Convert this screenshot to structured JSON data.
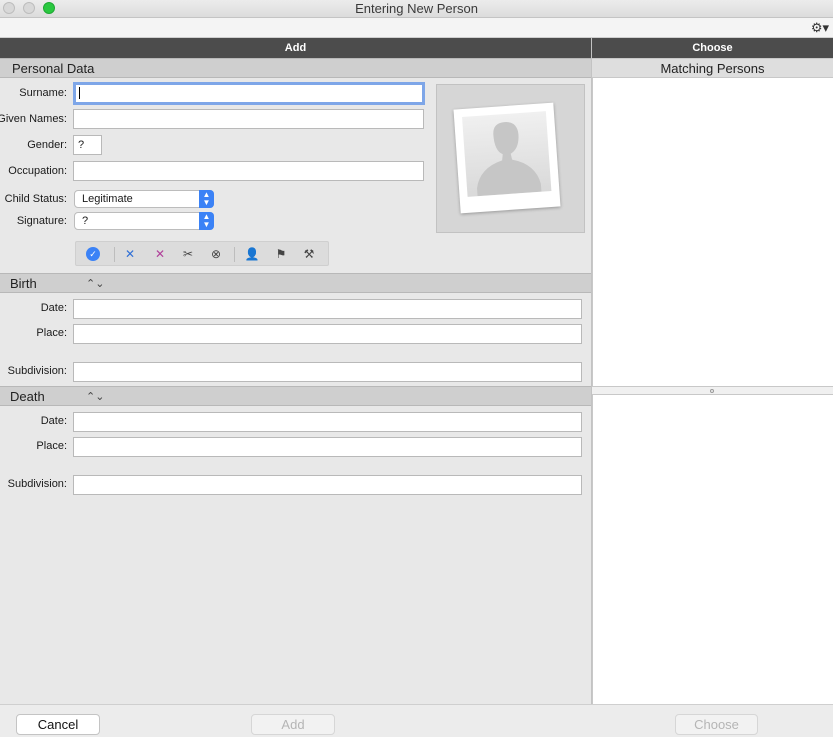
{
  "window": {
    "title": "Entering New Person"
  },
  "columns": {
    "add": "Add",
    "choose": "Choose"
  },
  "right": {
    "matching_title": "Matching Persons"
  },
  "personal": {
    "section_title": "Personal Data",
    "surname_label": "Surname:",
    "surname_value": "",
    "given_label": "Given Names:",
    "given_value": "",
    "gender_label": "Gender:",
    "gender_value": "?",
    "occupation_label": "Occupation:",
    "occupation_value": "",
    "child_status_label": "Child Status:",
    "child_status_value": "Legitimate",
    "signature_label": "Signature:",
    "signature_value": "?"
  },
  "birth": {
    "section_title": "Birth",
    "date_label": "Date:",
    "place_label": "Place:",
    "subdivision_label": "Subdivision:"
  },
  "death": {
    "section_title": "Death",
    "date_label": "Date:",
    "place_label": "Place:",
    "subdivision_label": "Subdivision:"
  },
  "buttons": {
    "cancel": "Cancel",
    "add": "Add",
    "choose": "Choose"
  },
  "icons": [
    "check-circle-icon",
    "merge-x-icon",
    "split-x-icon",
    "scissors-icon",
    "unlink-icon",
    "person-icon",
    "flag-icon",
    "hammer-icon"
  ],
  "colors": {
    "accent": "#3b82f6",
    "header_bg": "#4c4c4c",
    "focus_ring": "#7ea6e8"
  }
}
